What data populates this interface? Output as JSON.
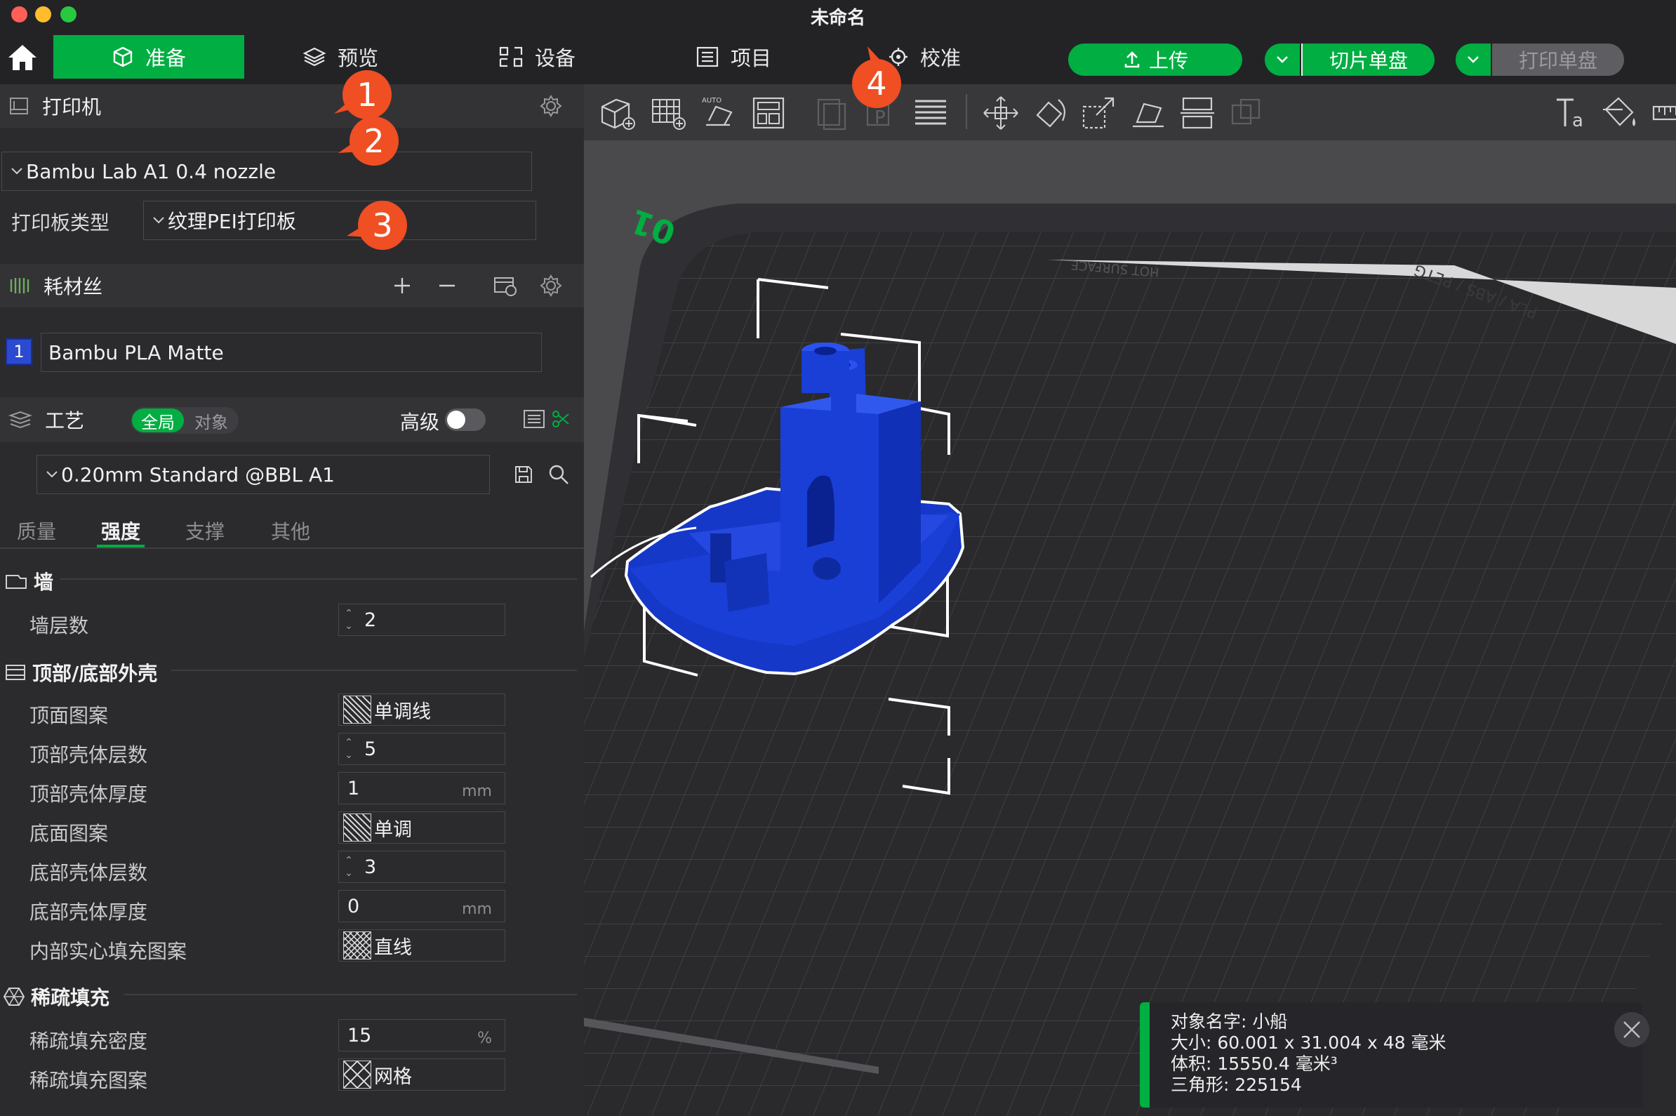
{
  "window": {
    "title": "未命名"
  },
  "nav": {
    "tabs": [
      {
        "label": "准备",
        "icon": "cube-icon"
      },
      {
        "label": "预览",
        "icon": "layers-icon"
      },
      {
        "label": "设备",
        "icon": "device-icon"
      },
      {
        "label": "项目",
        "icon": "list-icon"
      },
      {
        "label": "校准",
        "icon": "calibrate-icon"
      }
    ],
    "upload_label": "上传",
    "slice_label": "切片单盘",
    "print_label": "打印单盘"
  },
  "printer": {
    "section_label": "打印机",
    "selected": "Bambu Lab A1 0.4 nozzle",
    "plate_label": "打印板类型",
    "plate_value": "纹理PEI打印板"
  },
  "filament": {
    "section_label": "耗材丝",
    "slot_number": "1",
    "slot_color": "#2a4bd1",
    "selected": "Bambu PLA Matte"
  },
  "process": {
    "section_label": "工艺",
    "toggle_global": "全局",
    "toggle_object": "对象",
    "advanced_label": "高级",
    "preset": "0.20mm Standard @BBL A1",
    "subtabs": [
      "质量",
      "强度",
      "支撑",
      "其他"
    ],
    "active_subtab": "强度"
  },
  "settings": {
    "wall": {
      "title": "墙",
      "wall_loops_label": "墙层数",
      "wall_loops_value": "2"
    },
    "shell": {
      "title": "顶部/底部外壳",
      "top_pattern_label": "顶面图案",
      "top_pattern_value": "单调线",
      "top_layers_label": "顶部壳体层数",
      "top_layers_value": "5",
      "top_thickness_label": "顶部壳体厚度",
      "top_thickness_value": "1",
      "bottom_pattern_label": "底面图案",
      "bottom_pattern_value": "单调",
      "bottom_layers_label": "底部壳体层数",
      "bottom_layers_value": "3",
      "bottom_thickness_label": "底部壳体厚度",
      "bottom_thickness_value": "0",
      "internal_pattern_label": "内部实心填充图案",
      "internal_pattern_value": "直线",
      "unit_mm": "mm"
    },
    "infill": {
      "title": "稀疏填充",
      "density_label": "稀疏填充密度",
      "density_value": "15",
      "density_unit": "%",
      "pattern_label": "稀疏填充图案",
      "pattern_value": "网格"
    }
  },
  "callouts": [
    "1",
    "2",
    "3",
    "4"
  ],
  "plate": {
    "plate_number": "01",
    "label_surface": "HOT SURFACE",
    "label_materials": "PLA / ABS / PETG"
  },
  "object_info": {
    "name_line": "对象名字:  小船",
    "size_line": "大小:    60.001 x 31.004 x 48 毫米",
    "volume_line": "体积:    15550.4 毫米³",
    "triangles_line": "三角形:  225154"
  },
  "colors": {
    "accent": "#00ae42",
    "callout": "#f04e23",
    "model": "#1a3fd6"
  }
}
